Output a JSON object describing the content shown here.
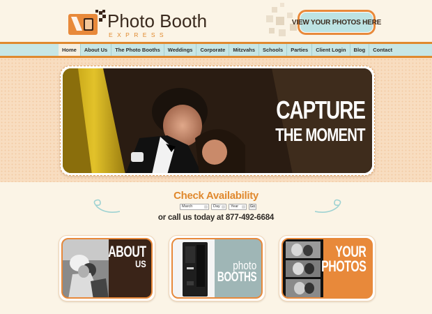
{
  "logo": {
    "title": "Photo Booth",
    "subtitle": "EXPRESS"
  },
  "header": {
    "view_photos_button": "VIEW YOUR PHOTOS HERE"
  },
  "nav": {
    "items": [
      {
        "label": "Home",
        "active": true
      },
      {
        "label": "About Us"
      },
      {
        "label": "The Photo Booths"
      },
      {
        "label": "Weddings"
      },
      {
        "label": "Corporate"
      },
      {
        "label": "Mitzvahs"
      },
      {
        "label": "Schools"
      },
      {
        "label": "Parties"
      },
      {
        "label": "Client Login"
      },
      {
        "label": "Blog"
      },
      {
        "label": "Contact"
      }
    ]
  },
  "hero": {
    "line1": "CAPTURE",
    "line2": "THE MOMENT"
  },
  "availability": {
    "title": "Check Availability",
    "month_value": "March",
    "day_value": "Day",
    "year_value": "Year",
    "go_label": "Go",
    "call_text": "or call us today at 877-492-6684"
  },
  "features": {
    "about": {
      "big": "ABOUT",
      "small": "US"
    },
    "booths": {
      "small": "photo",
      "big": "BOOTHS"
    },
    "photos": {
      "big": "YOUR",
      "big2": "PHOTOS"
    }
  },
  "colors": {
    "orange": "#e0892e",
    "teal": "#c7e6e5",
    "brown": "#3a2418",
    "cream": "#fbf4e6",
    "peach": "#f8ddc0"
  }
}
